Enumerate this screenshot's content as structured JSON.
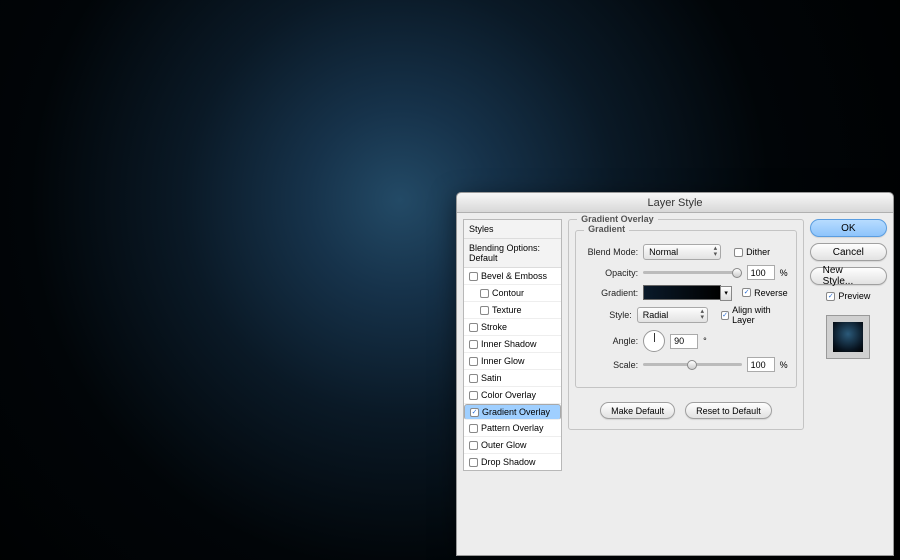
{
  "dialog": {
    "title": "Layer Style",
    "left": {
      "styles_header": "Styles",
      "blending_header": "Blending Options: Default",
      "items": [
        {
          "label": "Bevel & Emboss",
          "checked": false,
          "selected": false,
          "indent": false
        },
        {
          "label": "Contour",
          "checked": false,
          "selected": false,
          "indent": true
        },
        {
          "label": "Texture",
          "checked": false,
          "selected": false,
          "indent": true
        },
        {
          "label": "Stroke",
          "checked": false,
          "selected": false,
          "indent": false
        },
        {
          "label": "Inner Shadow",
          "checked": false,
          "selected": false,
          "indent": false
        },
        {
          "label": "Inner Glow",
          "checked": false,
          "selected": false,
          "indent": false
        },
        {
          "label": "Satin",
          "checked": false,
          "selected": false,
          "indent": false
        },
        {
          "label": "Color Overlay",
          "checked": false,
          "selected": false,
          "indent": false
        },
        {
          "label": "Gradient Overlay",
          "checked": true,
          "selected": true,
          "indent": false
        },
        {
          "label": "Pattern Overlay",
          "checked": false,
          "selected": false,
          "indent": false
        },
        {
          "label": "Outer Glow",
          "checked": false,
          "selected": false,
          "indent": false
        },
        {
          "label": "Drop Shadow",
          "checked": false,
          "selected": false,
          "indent": false
        }
      ]
    },
    "panel": {
      "section_title": "Gradient Overlay",
      "group_title": "Gradient",
      "blend_mode": {
        "label": "Blend Mode:",
        "value": "Normal"
      },
      "dither": {
        "label": "Dither",
        "checked": false
      },
      "opacity": {
        "label": "Opacity:",
        "value": "100",
        "unit": "%",
        "pos": 100
      },
      "gradient": {
        "label": "Gradient:"
      },
      "reverse": {
        "label": "Reverse",
        "checked": true
      },
      "style": {
        "label": "Style:",
        "value": "Radial"
      },
      "align": {
        "label": "Align with Layer",
        "checked": true
      },
      "angle": {
        "label": "Angle:",
        "value": "90",
        "unit": "°"
      },
      "scale": {
        "label": "Scale:",
        "value": "100",
        "unit": "%",
        "pos": 50
      },
      "make_default": "Make Default",
      "reset_default": "Reset to Default"
    },
    "right": {
      "ok": "OK",
      "cancel": "Cancel",
      "new_style": "New Style...",
      "preview": {
        "label": "Preview",
        "checked": true
      }
    }
  }
}
